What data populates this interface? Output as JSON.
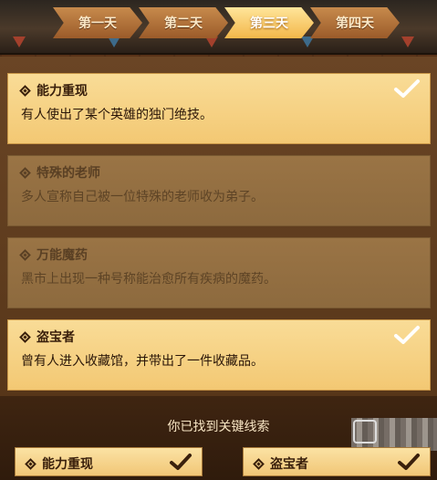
{
  "tabs": [
    {
      "label": "第一天",
      "active": false
    },
    {
      "label": "第二天",
      "active": false
    },
    {
      "label": "第三天",
      "active": true
    },
    {
      "label": "第四天",
      "active": false
    }
  ],
  "clues": [
    {
      "title": "能力重现",
      "desc": "有人使出了某个英雄的独门绝技。",
      "found": true
    },
    {
      "title": "特殊的老师",
      "desc": "多人宣称自己被一位特殊的老师收为弟子。",
      "found": false
    },
    {
      "title": "万能魔药",
      "desc": "黑市上出现一种号称能治愈所有疾病的魔药。",
      "found": false
    },
    {
      "title": "盗宝者",
      "desc": "曾有人进入收藏馆，并带出了一件收藏品。",
      "found": true
    }
  ],
  "found_section": {
    "title": "你已找到关键线索",
    "items": [
      "能力重现",
      "盗宝者"
    ]
  },
  "colors": {
    "card_active": "#f6d386",
    "card_inactive": "#957040",
    "tab_active": "#f7c75c",
    "tab_inactive": "#b57640"
  },
  "icons": [
    "diamond-icon",
    "checkmark-icon"
  ]
}
